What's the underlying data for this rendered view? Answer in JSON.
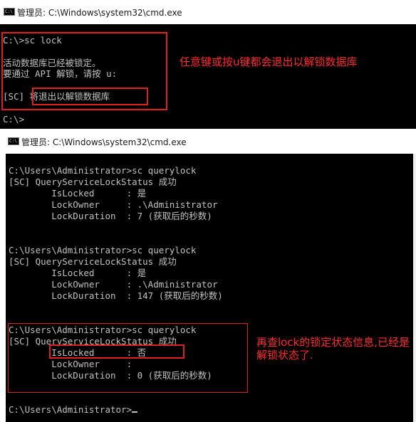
{
  "window1": {
    "title": "管理员: C:\\Windows\\system32\\cmd.exe",
    "lines": [
      "C:\\>sc lock",
      "",
      "活动数据库已经被锁定。",
      "要通过 API 解锁，请按 u:",
      "",
      "[SC] 将退出以解锁数据库",
      "",
      "C:\\>"
    ],
    "annotation": "任意键或按u键都会退出以解锁数据库"
  },
  "window2": {
    "title": "管理员: C:\\Windows\\system32\\cmd.exe",
    "lines": [
      "C:\\Users\\Administrator>sc querylock",
      "[SC] QueryServiceLockStatus 成功",
      "        IsLocked      : 是",
      "        LockOwner     : .\\Administrator",
      "        LockDuration  : 7 (获取后的秒数)",
      "",
      "",
      "C:\\Users\\Administrator>sc querylock",
      "[SC] QueryServiceLockStatus 成功",
      "        IsLocked      : 是",
      "        LockOwner     : .\\Administrator",
      "        LockDuration  : 147 (获取后的秒数)",
      "",
      "",
      "C:\\Users\\Administrator>sc querylock",
      "[SC] QueryServiceLockStatus 成功",
      "        IsLocked      : 否",
      "        LockOwner     :",
      "        LockDuration  : 0 (获取后的秒数)",
      "",
      "",
      "C:\\Users\\Administrator>"
    ],
    "annotation": "再查lock的锁定状态信息,已经是解锁状态了."
  },
  "colors": {
    "console_bg": "#000000",
    "console_text": "#c0c0c0",
    "annotation_red": "#ff2a2a",
    "box_red": "#e02020"
  }
}
